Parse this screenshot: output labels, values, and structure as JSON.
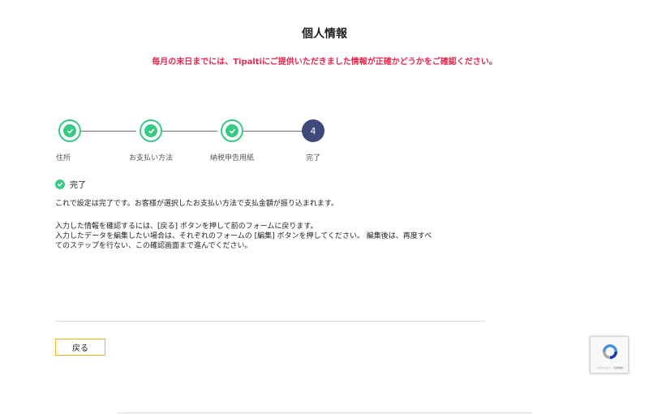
{
  "header": {
    "title": "個人情報",
    "notice": "毎月の末日までには、Tipaltiにご提供いただきました情報が正確かどうかをご確認ください。"
  },
  "steps": [
    {
      "label": "住所",
      "state": "done",
      "icon": "check-icon"
    },
    {
      "label": "お支払い方法",
      "state": "done",
      "icon": "check-icon"
    },
    {
      "label": "納税申告用紙",
      "state": "done",
      "icon": "check-icon"
    },
    {
      "label": "完了",
      "state": "active",
      "number": "4"
    }
  ],
  "status": {
    "label": "完了",
    "icon": "check-circle-icon"
  },
  "content": {
    "para1": "これで設定は完了です。お客様が選択したお支払い方法で支払金額が振り込まれます。",
    "para2_line1": "入力した情報を確認するには、[戻る] ボタンを押して前のフォームに戻ります。",
    "para2_line2": "入力したデータを編集したい場合は、それぞれのフォームの [編集] ボタンを押してください。 編集後は、再度すべ",
    "para2_line3": "てのステップを行ない、この確認画面まで進んでください。"
  },
  "actions": {
    "back_label": "戻る"
  },
  "recaptcha": {
    "icon": "recaptcha-icon",
    "text": "プライバシー・利用規約"
  },
  "colors": {
    "accent_green": "#38c985",
    "active_step": "#3d4a7a",
    "notice_red": "#e8264f",
    "button_border": "#f0b429"
  }
}
